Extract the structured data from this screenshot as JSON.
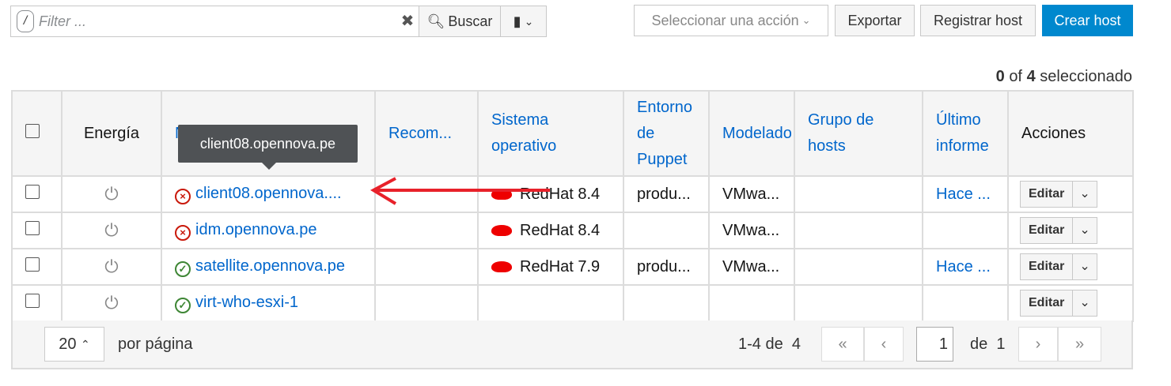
{
  "search": {
    "slash": "/",
    "placeholder": "Filter ...",
    "clear": "✖",
    "search_label": "Buscar",
    "bookmark": "▮",
    "chevron": "⌄"
  },
  "actions": {
    "select_action": "Seleccionar una acción",
    "export": "Exportar",
    "register": "Registrar host",
    "create": "Crear host"
  },
  "selection": {
    "count": "0",
    "of": "of",
    "total": "4",
    "label": "seleccionado"
  },
  "columns": [
    "Energía",
    "Nombre",
    "Recom...",
    "Sistema operativo",
    "Entorno de Puppet",
    "Modelado",
    "Grupo de hosts",
    "Último informe",
    "Acciones"
  ],
  "tooltip": "client08.opennova.pe",
  "rows": [
    {
      "status": "error",
      "name": "client08.opennova....",
      "os": "RedHat 8.4",
      "puppet": "produ...",
      "model": "VMwa...",
      "report": "Hace ...",
      "edit": "Editar"
    },
    {
      "status": "error",
      "name": "idm.opennova.pe",
      "os": "RedHat 8.4",
      "puppet": "",
      "model": "VMwa...",
      "report": "",
      "edit": "Editar"
    },
    {
      "status": "ok",
      "name": "satellite.opennova.pe",
      "os": "RedHat 7.9",
      "puppet": "produ...",
      "model": "VMwa...",
      "report": "Hace ...",
      "edit": "Editar"
    },
    {
      "status": "ok",
      "name": "virt-who-esxi-1",
      "os": "",
      "puppet": "",
      "model": "",
      "report": "",
      "edit": "Editar"
    }
  ],
  "pagination": {
    "per_page": "20",
    "per_page_label": "por página",
    "range": "1-4 de",
    "total": "4",
    "page": "1",
    "of": "de",
    "pages": "1"
  },
  "colors": {
    "accent": "#0066cc",
    "primary_button": "#0088ce",
    "annotation_arrow": "#e8212a"
  }
}
